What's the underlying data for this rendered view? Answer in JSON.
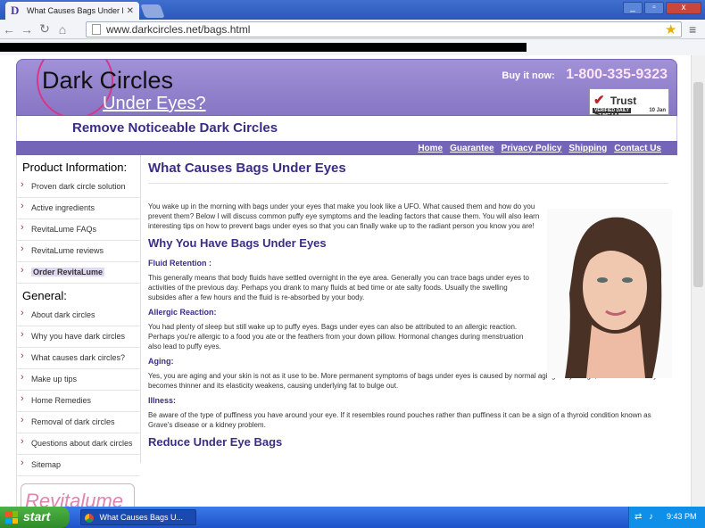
{
  "browser": {
    "tab_title": "What Causes Bags Under Ey",
    "tab_favicon": "D",
    "url": "www.darkcircles.net/bags.html",
    "window_buttons": [
      "_",
      "▫",
      "x"
    ]
  },
  "header": {
    "logo_main": "Dark Circles",
    "logo_sub": "Under Eyes?",
    "buy_label": "Buy it now:",
    "phone": "1-800-335-9323",
    "trust_title": "Trust Scan",
    "trust_verified": "VERIFIED DAILY",
    "trust_date": "10 Jan"
  },
  "tagline": "Remove Noticeable Dark Circles",
  "topnav": [
    "Home",
    "Guarantee",
    "Privacy Policy",
    "Shipping",
    "Contact Us"
  ],
  "sidebar": {
    "product_head": "Product Information:",
    "product_items": [
      "Proven dark circle solution",
      "Active ingredients",
      "RevitaLume FAQs",
      "RevitaLume reviews",
      "Order RevitaLume"
    ],
    "general_head": "General:",
    "general_items": [
      "About dark circles",
      "Why you have dark circles",
      "What causes dark circles?",
      "Make up tips",
      "Home Remedies",
      "Removal of dark circles",
      "Questions about dark circles",
      "Sitemap"
    ],
    "brand_box": "Revitalume"
  },
  "main": {
    "title": "What Causes Bags Under Eyes",
    "intro": "You wake up in the morning with bags under your eyes that make you look like a UFO. What caused them and how do you prevent them? Below I will discuss common puffy eye symptoms and the leading factors that cause them. You will also learn interesting tips on how to prevent bags under eyes so that you can finally wake up to the radiant person you know you are!",
    "h2_why": "Why You Have Bags Under Eyes",
    "fluid_head": "Fluid Retention :",
    "fluid_text": "This generally means that body fluids have settled overnight in the eye area. Generally you can trace bags under eyes to activities of the previous day. Perhaps you drank to many fluids at bed time or ate salty foods. Usually the swelling subsides after a few hours and the fluid is re-absorbed by your body.",
    "allergic_head": "Allergic Reaction:",
    "allergic_text": "You had plenty of sleep but still wake up to puffy eyes. Bags under eyes can also be attributed to an allergic reaction. Perhaps you're allergic to a food you ate or the feathers from your down pillow. Hormonal changes during menstruation also lead to puffy eyes.",
    "aging_head": "Aging:",
    "aging_text": "Yes, you are aging and your skin is not as it use to be. More permanent symptoms of bags under eyes is caused by normal aging. As you age, skin around the eyes becomes thinner and its elasticity weakens, causing underlying fat to bulge out.",
    "illness_head": "Illness:",
    "illness_text": "Be aware of the type of puffiness you have around your eye. If it resembles round pouches rather than puffiness it can be a sign of a thyroid condition known as Grave's disease or a kidney problem.",
    "h2_reduce": "Reduce Under Eye Bags"
  },
  "taskbar": {
    "start": "start",
    "window_title": "What Causes Bags U...",
    "clock": "9:43 PM"
  },
  "colors": {
    "header_purple": "#8676c4",
    "nav_purple": "#7465b8",
    "heading_purple": "#3b2d85",
    "phone_pink": "#ffe4f2",
    "taskbar_blue": "#245edb",
    "start_green": "#3c9a33"
  }
}
